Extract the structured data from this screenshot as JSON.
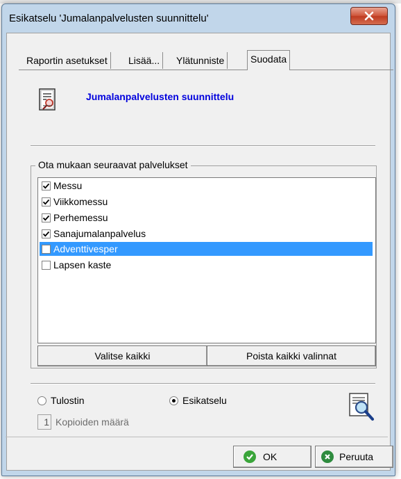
{
  "window": {
    "title": "Esikatselu 'Jumalanpalvelusten suunnittelu'",
    "close_label": "X"
  },
  "tabs": [
    {
      "label": "Raportin asetukset",
      "accel": "R"
    },
    {
      "label": "Lisää...",
      "accel": "L"
    },
    {
      "label": "Ylätunniste",
      "accel": "Y"
    },
    {
      "label": "Suodata",
      "accel": "S",
      "active": true
    }
  ],
  "report": {
    "title": "Jumalanpalvelusten suunnittelu",
    "icon": "report-document-icon"
  },
  "services": {
    "legend": "Ota mukaan seuraavat palvelukset",
    "items": [
      {
        "label": "Messu",
        "checked": true,
        "selected": false
      },
      {
        "label": "Viikkomessu",
        "checked": true,
        "selected": false
      },
      {
        "label": "Perhemessu",
        "checked": true,
        "selected": false
      },
      {
        "label": "Sanajumalanpalvelus",
        "checked": true,
        "selected": false
      },
      {
        "label": "Adventtivesper",
        "checked": false,
        "selected": true
      },
      {
        "label": "Lapsen kaste",
        "checked": false,
        "selected": false
      }
    ],
    "select_all_label": "Valitse kaikki",
    "clear_all_label": "Poista kaikki valinnat"
  },
  "output": {
    "printer_label": "Tulostin",
    "preview_label": "Esikatselu",
    "selected": "preview",
    "copies_value": "1",
    "copies_label": "Kopioiden määrä",
    "preview_icon": "magnifier-document-icon"
  },
  "footer": {
    "ok_label": "OK",
    "cancel_label": "Peruuta",
    "ok_icon": "check-icon",
    "cancel_icon": "cancel-icon",
    "accent_ok": "#3aa53a",
    "accent_cancel": "#2e8b3e"
  }
}
